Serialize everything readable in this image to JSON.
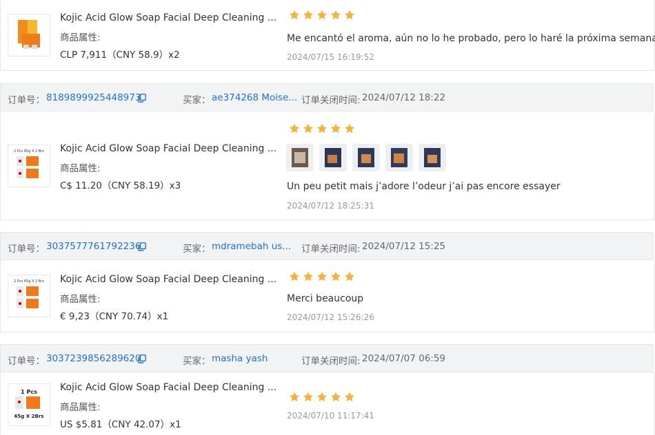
{
  "colors": {
    "accent": "#1f6fd6",
    "star": "#f5b13a",
    "header_bg": "#f2f3f5"
  },
  "labels": {
    "order_no": "订单号：",
    "buyer": "买家：",
    "close_time": "订单关闭时间:",
    "attributes": "商品属性:"
  },
  "orders": [
    {
      "product_title": "Kojic Acid Glow Soap Facial Deep Cleaning ...",
      "price": "CLP 7,911（CNY  58.9）x2",
      "review_text": "Me encantó el aroma, aún no lo he probado, pero lo haré la próxima semana.",
      "review_time": "2024/07/15 16:19:52",
      "stars": 5
    },
    {
      "order_no": "8189899925448973",
      "buyer": "ae374268 Moise...",
      "close_time": "2024/07/12 18:22",
      "product_title": "Kojic Acid Glow Soap Facial Deep Cleaning ...",
      "price": "C$ 11.20（CNY  58.19）x3",
      "review_text": "Un peu petit mais j’adore l’odeur j’ai pas encore essayer",
      "review_time": "2024/07/12 18:25:31",
      "stars": 5,
      "photo_count": 5
    },
    {
      "order_no": "3037577761792236",
      "buyer": "mdramebah us...",
      "close_time": "2024/07/12 15:25",
      "product_title": "Kojic Acid Glow Soap Facial Deep Cleaning ...",
      "price": "€ 9,23（CNY  70.74）x1",
      "review_text": "Merci beaucoup",
      "review_time": "2024/07/12 15:26:26",
      "stars": 5
    },
    {
      "order_no": "3037239856289620",
      "buyer": "masha yash",
      "close_time": "2024/07/07 06:59",
      "product_title": "Kojic Acid Glow Soap Facial Deep Cleaning ...",
      "price": "US $5.81（CNY  42.07）x1",
      "review_time": "2024/07/10 11:17:41",
      "stars": 5
    }
  ],
  "thumb_text": {
    "pack_2": "2 Pcs 65g X 2 Brs",
    "pack_1_top": "1 Pcs",
    "pack_1_bottom": "65g X 2Brs"
  }
}
